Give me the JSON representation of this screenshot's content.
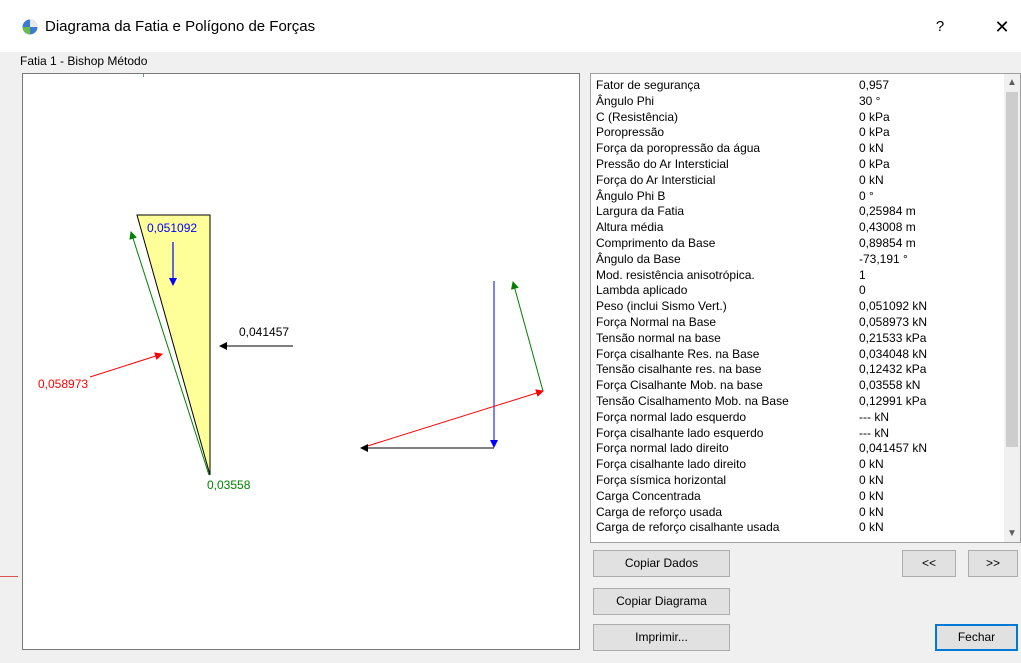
{
  "window": {
    "title": "Diagrama da Fatia e Polígono de Forças",
    "help_label": "?",
    "close_label": "✕"
  },
  "subtitle": "Fatia  1 - Bishop  Método",
  "diagram": {
    "label_weight": "0,051092",
    "label_right": "0,041457",
    "label_normal": "0,058973",
    "label_shear": "0,03558",
    "colors": {
      "slice_fill": "#ffff99",
      "weight": "#0000ff",
      "normal": "#ff0000",
      "shear": "#008000",
      "side": "#000000"
    }
  },
  "properties": [
    {
      "label": "Fator de segurança",
      "value": "0,957"
    },
    {
      "label": "Ângulo Phi",
      "value": "30 °"
    },
    {
      "label": "C (Resistência)",
      "value": "0 kPa"
    },
    {
      "label": "Poropressão",
      "value": "0 kPa"
    },
    {
      "label": "Força da poropressão da água",
      "value": "0 kN"
    },
    {
      "label": "Pressão do Ar Intersticial",
      "value": "0 kPa"
    },
    {
      "label": "Força do Ar Intersticial",
      "value": "0 kN"
    },
    {
      "label": "Ângulo Phi B",
      "value": "0 °"
    },
    {
      "label": "Largura da Fatia",
      "value": "0,25984 m"
    },
    {
      "label": "Altura média",
      "value": "0,43008 m"
    },
    {
      "label": "Comprimento da Base",
      "value": "0,89854 m"
    },
    {
      "label": "Ângulo da Base",
      "value": "-73,191 °"
    },
    {
      "label": "Mod. resistência anisotrópica.",
      "value": "1"
    },
    {
      "label": "Lambda aplicado",
      "value": "0"
    },
    {
      "label": "Peso (inclui Sismo Vert.)",
      "value": "0,051092 kN"
    },
    {
      "label": "Força Normal na Base",
      "value": "0,058973 kN"
    },
    {
      "label": "Tensão normal na base",
      "value": "0,21533 kPa"
    },
    {
      "label": "Força cisalhante Res. na Base",
      "value": "0,034048 kN"
    },
    {
      "label": "Tensão cisalhante res. na base",
      "value": "0,12432 kPa"
    },
    {
      "label": "Força Cisalhante Mob. na base",
      "value": "0,03558 kN"
    },
    {
      "label": "Tensão Cisalhamento Mob. na Base",
      "value": "0,12991 kPa"
    },
    {
      "label": "Força normal lado esquerdo",
      "value": "--- kN"
    },
    {
      "label": "Força cisalhante lado esquerdo",
      "value": "--- kN"
    },
    {
      "label": "Força normal lado direito",
      "value": "0,041457 kN"
    },
    {
      "label": "Força cisalhante lado direito",
      "value": "0 kN"
    },
    {
      "label": "Força sísmica horizontal",
      "value": "0 kN"
    },
    {
      "label": "Carga Concentrada",
      "value": "0 kN"
    },
    {
      "label": "Carga de reforço usada",
      "value": "0 kN"
    },
    {
      "label": "Carga de reforço cisalhante usada",
      "value": "0 kN"
    }
  ],
  "buttons": {
    "copy_data": "Copiar Dados",
    "copy_diagram": "Copiar Diagrama",
    "print": "Imprimir...",
    "prev": "<<",
    "next": ">>",
    "close": "Fechar"
  }
}
